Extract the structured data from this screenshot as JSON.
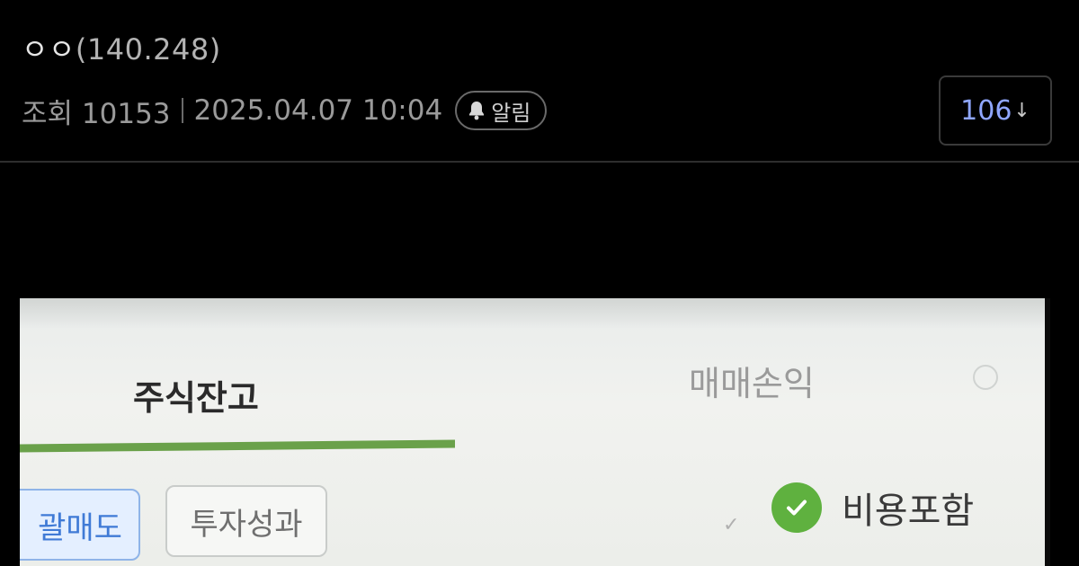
{
  "post": {
    "author_name": "ㅇㅇ",
    "author_ip": "(140.248)",
    "views_label": "조회 10153",
    "datetime": "2025.04.07 10:04",
    "alarm_label": "알림",
    "comment_count": "106"
  },
  "photo": {
    "tab_stock": "주식잔고",
    "tab_trade": "매매손익",
    "chip_active": "괄매도",
    "chip_inactive": "투자성과",
    "cost_label": "비용포함"
  },
  "colors": {
    "background": "#000000",
    "comment_count": "#8fa6ff",
    "tab_underline": "#6aa14a",
    "check_green": "#5fb13f",
    "chip_blue": "#3f7ad6"
  },
  "icons": {
    "alarm": "bell-icon",
    "comment_arrow": "arrow-down-icon",
    "cost_check": "check-circle-icon"
  }
}
